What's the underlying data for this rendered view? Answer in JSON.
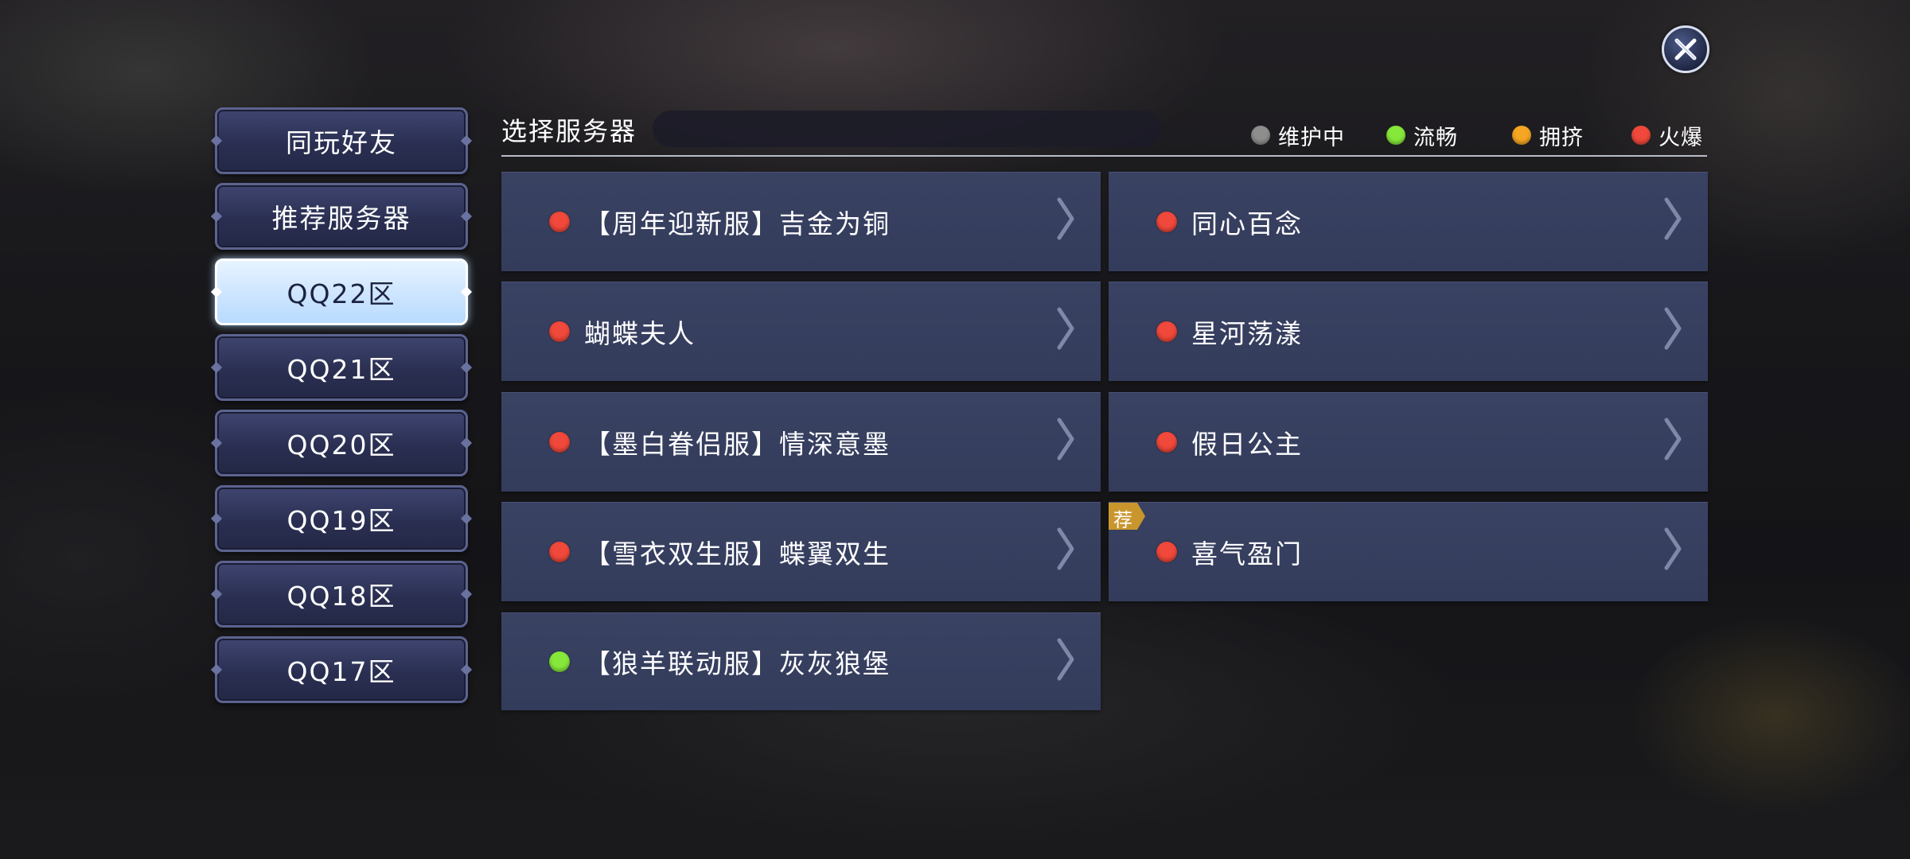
{
  "close": {
    "icon": "close-icon"
  },
  "tabs": [
    {
      "label": "同玩好友",
      "active": false
    },
    {
      "label": "推荐服务器",
      "active": false
    },
    {
      "label": "QQ22区",
      "active": true
    },
    {
      "label": "QQ21区",
      "active": false
    },
    {
      "label": "QQ20区",
      "active": false
    },
    {
      "label": "QQ19区",
      "active": false
    },
    {
      "label": "QQ18区",
      "active": false
    },
    {
      "label": "QQ17区",
      "active": false
    }
  ],
  "header": {
    "title": "选择服务器"
  },
  "legend": [
    {
      "label": "维护中",
      "color": "#8e8e8e"
    },
    {
      "label": "流畅",
      "color": "#86e83a"
    },
    {
      "label": "拥挤",
      "color": "#f5a623"
    },
    {
      "label": "火爆",
      "color": "#f0483a"
    }
  ],
  "servers": [
    {
      "name": "【周年迎新服】吉金为铜",
      "status_color": "#f0483a",
      "recommended": false
    },
    {
      "name": "同心百念",
      "status_color": "#f0483a",
      "recommended": false
    },
    {
      "name": "蝴蝶夫人",
      "status_color": "#f0483a",
      "recommended": false
    },
    {
      "name": "星河荡漾",
      "status_color": "#f0483a",
      "recommended": false
    },
    {
      "name": "【墨白眷侣服】情深意墨",
      "status_color": "#f0483a",
      "recommended": false
    },
    {
      "name": "假日公主",
      "status_color": "#f0483a",
      "recommended": false
    },
    {
      "name": "【雪衣双生服】蝶翼双生",
      "status_color": "#f0483a",
      "recommended": false
    },
    {
      "name": "喜气盈门",
      "status_color": "#f0483a",
      "recommended": true
    },
    {
      "name": "【狼羊联动服】灰灰狼堡",
      "status_color": "#86e83a",
      "recommended": false
    }
  ],
  "recommend_badge": "荐"
}
